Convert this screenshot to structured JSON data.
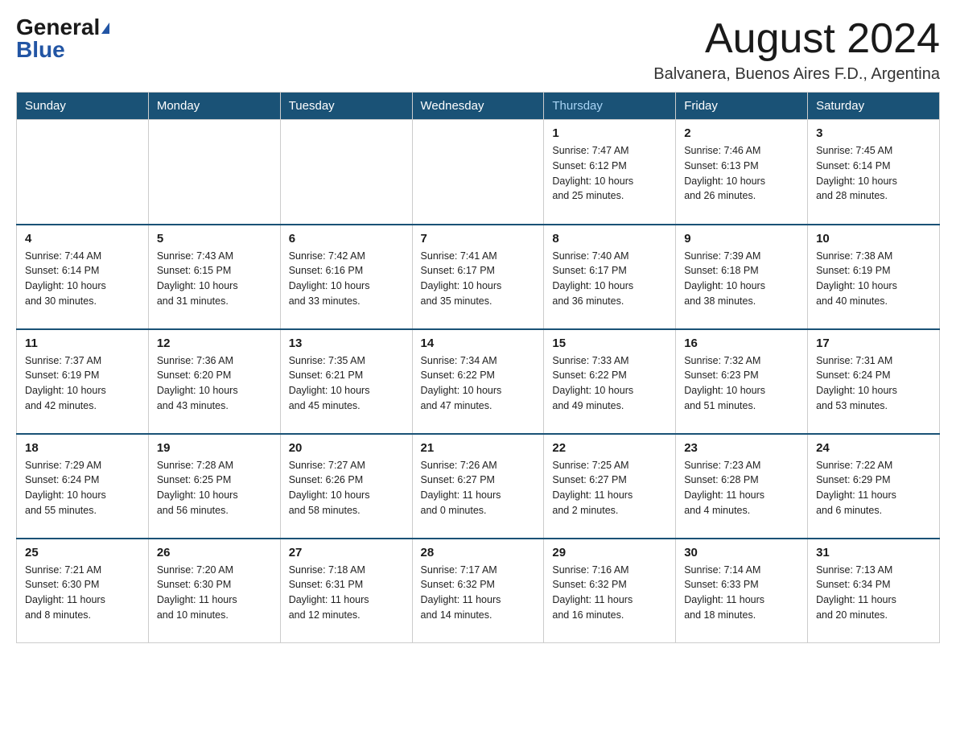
{
  "header": {
    "logo_general": "General",
    "logo_blue": "Blue",
    "month_year": "August 2024",
    "location": "Balvanera, Buenos Aires F.D., Argentina"
  },
  "weekdays": [
    "Sunday",
    "Monday",
    "Tuesday",
    "Wednesday",
    "Thursday",
    "Friday",
    "Saturday"
  ],
  "weeks": [
    {
      "days": [
        {
          "day": "",
          "info": ""
        },
        {
          "day": "",
          "info": ""
        },
        {
          "day": "",
          "info": ""
        },
        {
          "day": "",
          "info": ""
        },
        {
          "day": "1",
          "info": "Sunrise: 7:47 AM\nSunset: 6:12 PM\nDaylight: 10 hours\nand 25 minutes."
        },
        {
          "day": "2",
          "info": "Sunrise: 7:46 AM\nSunset: 6:13 PM\nDaylight: 10 hours\nand 26 minutes."
        },
        {
          "day": "3",
          "info": "Sunrise: 7:45 AM\nSunset: 6:14 PM\nDaylight: 10 hours\nand 28 minutes."
        }
      ]
    },
    {
      "days": [
        {
          "day": "4",
          "info": "Sunrise: 7:44 AM\nSunset: 6:14 PM\nDaylight: 10 hours\nand 30 minutes."
        },
        {
          "day": "5",
          "info": "Sunrise: 7:43 AM\nSunset: 6:15 PM\nDaylight: 10 hours\nand 31 minutes."
        },
        {
          "day": "6",
          "info": "Sunrise: 7:42 AM\nSunset: 6:16 PM\nDaylight: 10 hours\nand 33 minutes."
        },
        {
          "day": "7",
          "info": "Sunrise: 7:41 AM\nSunset: 6:17 PM\nDaylight: 10 hours\nand 35 minutes."
        },
        {
          "day": "8",
          "info": "Sunrise: 7:40 AM\nSunset: 6:17 PM\nDaylight: 10 hours\nand 36 minutes."
        },
        {
          "day": "9",
          "info": "Sunrise: 7:39 AM\nSunset: 6:18 PM\nDaylight: 10 hours\nand 38 minutes."
        },
        {
          "day": "10",
          "info": "Sunrise: 7:38 AM\nSunset: 6:19 PM\nDaylight: 10 hours\nand 40 minutes."
        }
      ]
    },
    {
      "days": [
        {
          "day": "11",
          "info": "Sunrise: 7:37 AM\nSunset: 6:19 PM\nDaylight: 10 hours\nand 42 minutes."
        },
        {
          "day": "12",
          "info": "Sunrise: 7:36 AM\nSunset: 6:20 PM\nDaylight: 10 hours\nand 43 minutes."
        },
        {
          "day": "13",
          "info": "Sunrise: 7:35 AM\nSunset: 6:21 PM\nDaylight: 10 hours\nand 45 minutes."
        },
        {
          "day": "14",
          "info": "Sunrise: 7:34 AM\nSunset: 6:22 PM\nDaylight: 10 hours\nand 47 minutes."
        },
        {
          "day": "15",
          "info": "Sunrise: 7:33 AM\nSunset: 6:22 PM\nDaylight: 10 hours\nand 49 minutes."
        },
        {
          "day": "16",
          "info": "Sunrise: 7:32 AM\nSunset: 6:23 PM\nDaylight: 10 hours\nand 51 minutes."
        },
        {
          "day": "17",
          "info": "Sunrise: 7:31 AM\nSunset: 6:24 PM\nDaylight: 10 hours\nand 53 minutes."
        }
      ]
    },
    {
      "days": [
        {
          "day": "18",
          "info": "Sunrise: 7:29 AM\nSunset: 6:24 PM\nDaylight: 10 hours\nand 55 minutes."
        },
        {
          "day": "19",
          "info": "Sunrise: 7:28 AM\nSunset: 6:25 PM\nDaylight: 10 hours\nand 56 minutes."
        },
        {
          "day": "20",
          "info": "Sunrise: 7:27 AM\nSunset: 6:26 PM\nDaylight: 10 hours\nand 58 minutes."
        },
        {
          "day": "21",
          "info": "Sunrise: 7:26 AM\nSunset: 6:27 PM\nDaylight: 11 hours\nand 0 minutes."
        },
        {
          "day": "22",
          "info": "Sunrise: 7:25 AM\nSunset: 6:27 PM\nDaylight: 11 hours\nand 2 minutes."
        },
        {
          "day": "23",
          "info": "Sunrise: 7:23 AM\nSunset: 6:28 PM\nDaylight: 11 hours\nand 4 minutes."
        },
        {
          "day": "24",
          "info": "Sunrise: 7:22 AM\nSunset: 6:29 PM\nDaylight: 11 hours\nand 6 minutes."
        }
      ]
    },
    {
      "days": [
        {
          "day": "25",
          "info": "Sunrise: 7:21 AM\nSunset: 6:30 PM\nDaylight: 11 hours\nand 8 minutes."
        },
        {
          "day": "26",
          "info": "Sunrise: 7:20 AM\nSunset: 6:30 PM\nDaylight: 11 hours\nand 10 minutes."
        },
        {
          "day": "27",
          "info": "Sunrise: 7:18 AM\nSunset: 6:31 PM\nDaylight: 11 hours\nand 12 minutes."
        },
        {
          "day": "28",
          "info": "Sunrise: 7:17 AM\nSunset: 6:32 PM\nDaylight: 11 hours\nand 14 minutes."
        },
        {
          "day": "29",
          "info": "Sunrise: 7:16 AM\nSunset: 6:32 PM\nDaylight: 11 hours\nand 16 minutes."
        },
        {
          "day": "30",
          "info": "Sunrise: 7:14 AM\nSunset: 6:33 PM\nDaylight: 11 hours\nand 18 minutes."
        },
        {
          "day": "31",
          "info": "Sunrise: 7:13 AM\nSunset: 6:34 PM\nDaylight: 11 hours\nand 20 minutes."
        }
      ]
    }
  ]
}
